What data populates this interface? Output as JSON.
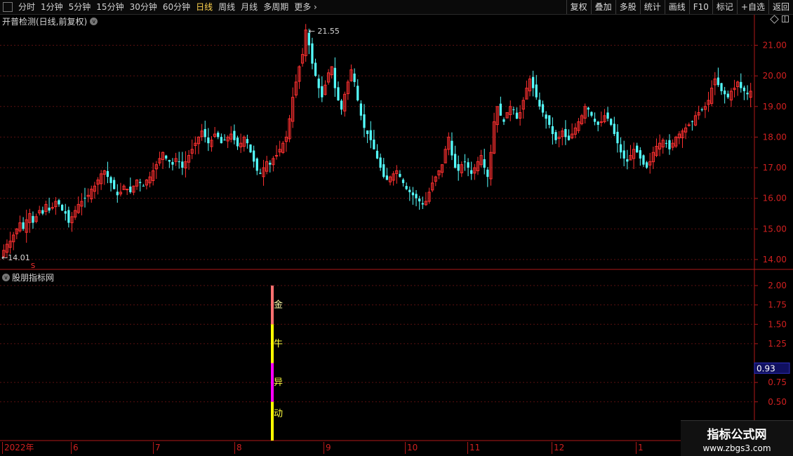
{
  "toolbar": {
    "timeframes": [
      "分时",
      "1分钟",
      "5分钟",
      "15分钟",
      "30分钟",
      "60分钟",
      "日线",
      "周线",
      "月线",
      "多周期",
      "更多"
    ],
    "active": "日线",
    "more_suffix": "›",
    "tools": [
      "复权",
      "叠加",
      "多股",
      "统计",
      "画线",
      "F10",
      "标记",
      "+自选",
      "返回"
    ]
  },
  "main_panel": {
    "title": "开普检测(日线,前复权)",
    "high_label": "21.55",
    "low_label": "14.01",
    "s_marker": "S",
    "price_ticks": [
      "21.00",
      "20.00",
      "19.00",
      "18.00",
      "17.00",
      "16.00",
      "15.00",
      "14.00"
    ]
  },
  "indicator_panel": {
    "title": "股朋指标网",
    "ticks": [
      "2.00",
      "1.75",
      "1.50",
      "1.25",
      "0.75",
      "0.50"
    ],
    "current_value": "0.93",
    "chars": [
      "金",
      "牛",
      "异",
      "动"
    ]
  },
  "date_axis": {
    "labels": [
      "2022年",
      "6",
      "7",
      "8",
      "9",
      "10",
      "11",
      "12",
      "1"
    ]
  },
  "watermark": {
    "title": "指标公式网",
    "url": "www.zbgs3.com"
  },
  "colors": {
    "up": "#ff3030",
    "down": "#54ffff",
    "axis": "#b01818",
    "bar_gold": "#ff7070",
    "bar_yellow": "#ffff00",
    "bar_magenta": "#ff00ff",
    "highlight_box": "#101060"
  },
  "chart_data": {
    "type": "candlestick",
    "y_range": [
      13.7,
      21.7
    ],
    "indicator_range": [
      0,
      2.1
    ],
    "indicator_value": 0.93,
    "series": [
      {
        "values": [
          14.3,
          14.5,
          14.6,
          14.8,
          15.0,
          15.2,
          15.0,
          15.3,
          15.5,
          15.2,
          15.4,
          15.6,
          15.5,
          15.8,
          15.6,
          15.7,
          15.9,
          15.8,
          15.6,
          15.5,
          15.2,
          15.4,
          15.6,
          15.8,
          15.9,
          16.0,
          16.1,
          16.3,
          16.4,
          16.6,
          16.8,
          16.9,
          16.7,
          16.5,
          16.3,
          16.1,
          16.2,
          16.4,
          16.3,
          16.2,
          16.4,
          16.6,
          16.5,
          16.4,
          16.6,
          16.7,
          16.9,
          17.1,
          17.3,
          17.5,
          17.3,
          17.2,
          17.1,
          17.3,
          17.2,
          17.0,
          17.2,
          17.4,
          17.6,
          17.8,
          18.0,
          18.2,
          18.0,
          17.8,
          17.9,
          18.1,
          18.0,
          17.8,
          17.9,
          18.0,
          18.1,
          17.9,
          17.7,
          17.8,
          18.0,
          17.8,
          17.5,
          17.2,
          16.9,
          16.8,
          17.0,
          17.2,
          17.1,
          17.3,
          17.4,
          17.6,
          17.8,
          18.0,
          18.6,
          19.3,
          19.8,
          20.3,
          20.7,
          21.5,
          21.0,
          20.4,
          20.0,
          19.6,
          19.3,
          19.7,
          20.1,
          20.3,
          19.6,
          19.2,
          18.9,
          19.4,
          19.8,
          20.2,
          19.8,
          19.2,
          18.7,
          18.3,
          18.1,
          17.9,
          17.6,
          17.3,
          17.0,
          16.7,
          16.6,
          16.7,
          16.8,
          16.9,
          16.7,
          16.5,
          16.3,
          16.2,
          16.1,
          16.0,
          15.9,
          15.8,
          15.9,
          16.2,
          16.5,
          16.7,
          16.9,
          17.1,
          17.6,
          18.0,
          17.4,
          17.0,
          16.9,
          17.1,
          17.2,
          17.0,
          16.8,
          17.0,
          17.2,
          17.4,
          17.0,
          16.7,
          17.5,
          18.5,
          19.0,
          18.7,
          18.5,
          18.8,
          19.0,
          18.9,
          18.6,
          18.8,
          19.2,
          19.6,
          19.9,
          19.6,
          19.3,
          19.0,
          18.8,
          18.6,
          18.4,
          18.1,
          17.9,
          18.0,
          18.2,
          18.0,
          17.9,
          18.1,
          18.3,
          18.5,
          18.7,
          19.0,
          18.9,
          18.7,
          18.5,
          18.4,
          18.5,
          18.7,
          18.6,
          18.4,
          18.1,
          17.8,
          17.5,
          17.3,
          17.2,
          17.4,
          17.6,
          17.5,
          17.3,
          17.1,
          17.0,
          17.2,
          17.5,
          17.7,
          17.8,
          17.9,
          17.8,
          17.6,
          17.8,
          18.0,
          18.1,
          18.2,
          18.3,
          18.4,
          18.5,
          18.7,
          18.8,
          18.9,
          19.0,
          19.2,
          19.6,
          19.9,
          19.7,
          19.5,
          19.4,
          19.3,
          19.5,
          19.6,
          19.8,
          19.6,
          19.5,
          19.4,
          19.5
        ]
      }
    ]
  }
}
